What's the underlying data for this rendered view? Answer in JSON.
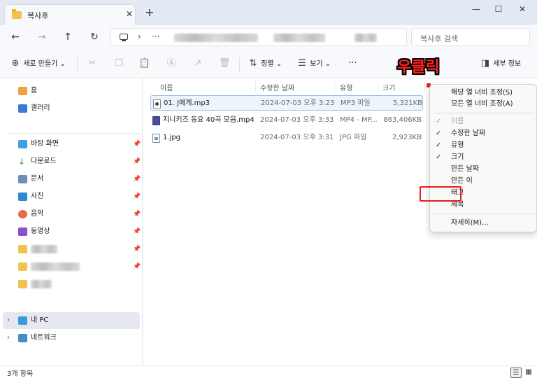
{
  "tab": {
    "title": "복사후",
    "close": "✕",
    "add": "+"
  },
  "window_controls": {
    "minimize": "—",
    "maximize": "☐",
    "close": "✕"
  },
  "nav": {
    "back": "←",
    "forward": "→",
    "up": "↑",
    "refresh": "↻",
    "separator": "›",
    "more": "···"
  },
  "search": {
    "placeholder": "복사후 검색"
  },
  "toolbar": {
    "new": "새로 만들기 ⌄",
    "sort": "정렬 ⌄",
    "view": "보기 ⌄",
    "more": "···",
    "details": "세부 정보"
  },
  "sidebar": {
    "home": "홈",
    "gallery": "갤러리",
    "desktop": "바탕 화면",
    "downloads": "다운로드",
    "documents": "문서",
    "pictures": "사진",
    "music": "음악",
    "videos": "동영상",
    "this_pc": "내 PC",
    "network": "네트워크"
  },
  "columns": {
    "name": "이름",
    "date": "수정한 날짜",
    "type": "유형",
    "size": "크기"
  },
  "files": [
    {
      "name": "01. J에게.mp3",
      "date": "2024-07-03 오후 3:23",
      "type": "MP3 파일",
      "size": "5,321KB"
    },
    {
      "name": "지니키즈 동요 40곡 모음.mp4",
      "date": "2024-07-03 오후 3:33",
      "type": "MP4 - MP...",
      "size": "863,406KB"
    },
    {
      "name": "1.jpg",
      "date": "2024-07-03 오후 3:31",
      "type": "JPG 파일",
      "size": "2,923KB"
    }
  ],
  "context_menu": {
    "fit_column": "해당 열 너비 조정(S)",
    "fit_all": "모든 열 너비 조정(A)",
    "col_name": "이름",
    "col_modified": "수정한 날짜",
    "col_type": "유형",
    "col_size": "크기",
    "col_created": "만든 날짜",
    "col_author": "만든 이",
    "col_tags": "태그",
    "col_title": "제목",
    "more": "자세히(M)..."
  },
  "annotation": {
    "text": "우클릭",
    "color": "#ff2222"
  },
  "status": {
    "count": "3개 항목"
  },
  "colors": {
    "highlight": "#e81a1a",
    "selected_row_border": "#9bbde8"
  }
}
